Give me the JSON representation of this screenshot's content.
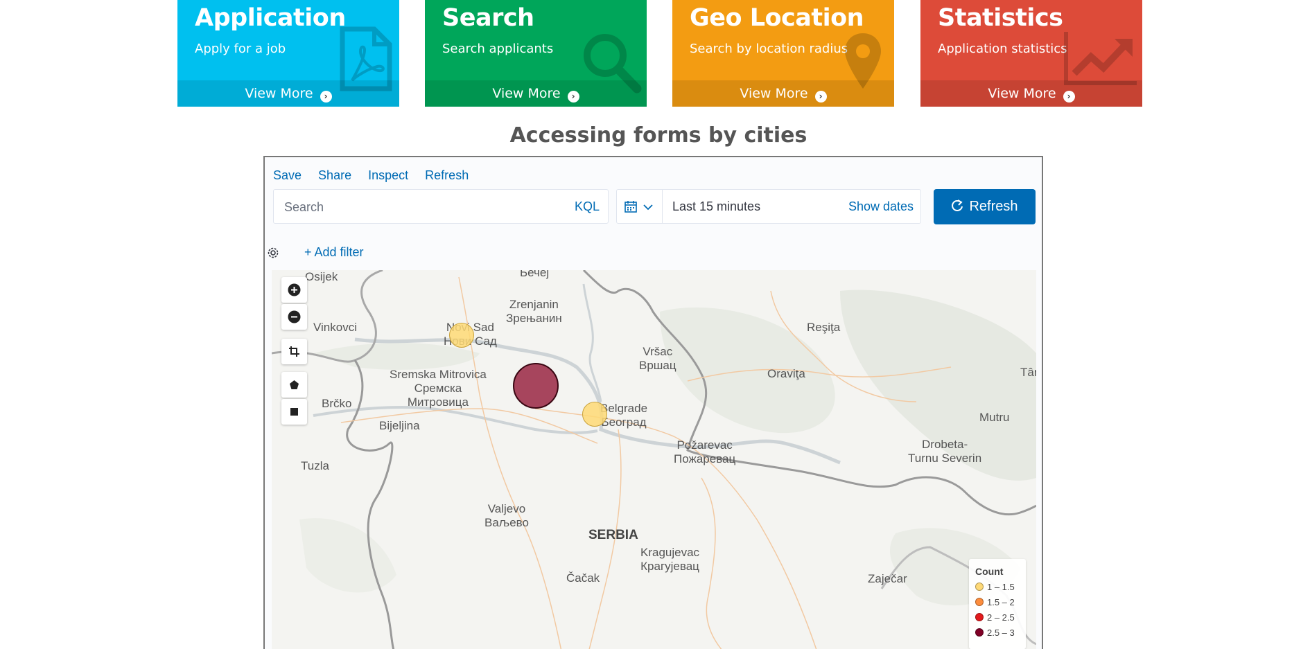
{
  "tiles": [
    {
      "title": "Application",
      "subtitle": "Apply for a job",
      "footer": "View More",
      "color": "#00c0ef",
      "icon": "pdf-file-icon"
    },
    {
      "title": "Search",
      "subtitle": "Search applicants",
      "footer": "View More",
      "color": "#00a65a",
      "icon": "search-icon"
    },
    {
      "title": "Geo Location",
      "subtitle": "Search by location radius",
      "footer": "View More",
      "color": "#f39c12",
      "icon": "map-pin-icon"
    },
    {
      "title": "Statistics",
      "subtitle": "Application statistics",
      "footer": "View More",
      "color": "#dd4b39",
      "icon": "line-chart-icon"
    }
  ],
  "heading": "Accessing forms by cities",
  "kibana": {
    "topnav": [
      "Save",
      "Share",
      "Inspect",
      "Refresh"
    ],
    "search": {
      "placeholder": "Search",
      "language": "KQL"
    },
    "date": {
      "range": "Last 15 minutes",
      "show_dates": "Show dates"
    },
    "refresh_button": "Refresh",
    "add_filter": "+ Add filter"
  },
  "map": {
    "cities": [
      {
        "name": "Osijek",
        "alt": ""
      },
      {
        "name": "Бечеј",
        "alt": ""
      },
      {
        "name": "Zrenjanin",
        "alt": "Зрењанин"
      },
      {
        "name": "Vinkovci",
        "alt": ""
      },
      {
        "name": "Novi Sad",
        "alt": "Нови Сад"
      },
      {
        "name": "Reşiţa",
        "alt": ""
      },
      {
        "name": "Vršac",
        "alt": "Вршац"
      },
      {
        "name": "Oraviţa",
        "alt": ""
      },
      {
        "name": "Târ",
        "alt": ""
      },
      {
        "name": "Sremska Mitrovica",
        "alt": "Сремска\nМитровица"
      },
      {
        "name": "Brčko",
        "alt": ""
      },
      {
        "name": "Bijeljina",
        "alt": ""
      },
      {
        "name": "Belgrade",
        "alt": "Београд"
      },
      {
        "name": "Mutru",
        "alt": ""
      },
      {
        "name": "Požarevac",
        "alt": "Пожаревац"
      },
      {
        "name": "Drobeta-",
        "alt": "Turnu Severin"
      },
      {
        "name": "Tuzla",
        "alt": ""
      },
      {
        "name": "Valjevo",
        "alt": "Ваљево"
      },
      {
        "name": "SERBIA",
        "alt": ""
      },
      {
        "name": "Kragujevac",
        "alt": "Крагујевац"
      },
      {
        "name": "Čačak",
        "alt": ""
      },
      {
        "name": "Zaječar",
        "alt": ""
      }
    ],
    "legend": {
      "title": "Count",
      "items": [
        {
          "label": "1 – 1.5",
          "color": "#fed976"
        },
        {
          "label": "1.5 – 2",
          "color": "#fd8d3c"
        },
        {
          "label": "2 – 2.5",
          "color": "#e31a1c"
        },
        {
          "label": "2.5 – 3",
          "color": "#800026"
        }
      ]
    },
    "bubbles": [
      {
        "city": "Novi Sad",
        "count": 1,
        "color": "#fed976"
      },
      {
        "city": "Sremska Mitrovica",
        "count": 3,
        "color": "#a5334e"
      },
      {
        "city": "Belgrade",
        "count": 1,
        "color": "#fed976"
      }
    ]
  }
}
